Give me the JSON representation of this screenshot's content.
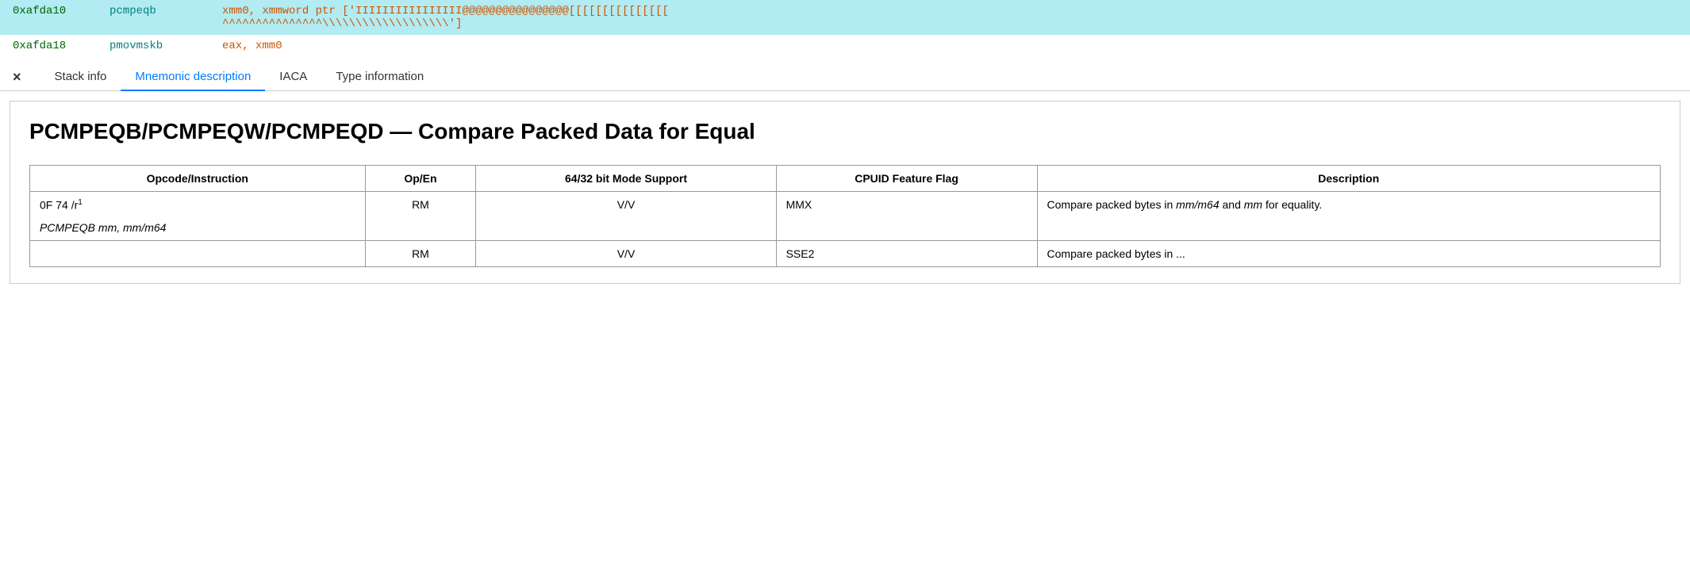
{
  "asm": {
    "rows": [
      {
        "selected": true,
        "addr": "0xafda10",
        "mnemonic": "pcmpeqb",
        "operands": "xmm0, xmmword ptr ['IIIIIIIIIIIIIIII@@@@@@@@@@@@@@@@[[[[[[[[[[[[[[[",
        "operands2": "^^^^^^^^^^^^^^^\\\\\\\\\\\\\\\\\\\\\\\\\\\\\\\\\\\\\\']"
      },
      {
        "selected": false,
        "addr": "0xafda18",
        "mnemonic": "pmovmskb",
        "operands": "eax, xmm0",
        "operands2": ""
      }
    ]
  },
  "tabs": {
    "close_label": "×",
    "items": [
      {
        "id": "stack-info",
        "label": "Stack info",
        "active": false
      },
      {
        "id": "mnemonic-description",
        "label": "Mnemonic description",
        "active": true
      },
      {
        "id": "iaca",
        "label": "IACA",
        "active": false
      },
      {
        "id": "type-information",
        "label": "Type information",
        "active": false
      }
    ]
  },
  "doc": {
    "title": "PCMPEQB/PCMPEQW/PCMPEQD — Compare Packed Data for Equal",
    "table": {
      "headers": [
        "Opcode/Instruction",
        "Op/En",
        "64/32 bit Mode Support",
        "CPUID Feature Flag",
        "Description"
      ],
      "rows": [
        {
          "opcode": "0F 74 /r",
          "superscript": "1",
          "instruction": "PCMPEQB mm, mm/m64",
          "opEn": "RM",
          "mode": "V/V",
          "cpuid": "MMX",
          "description_pre": "Compare packed bytes in ",
          "description_italic1": "mm/m64",
          "description_mid": " and ",
          "description_italic2": "mm",
          "description_post": " for equality."
        },
        {
          "opcode": "",
          "superscript": "",
          "instruction": "",
          "opEn": "RM",
          "mode": "V/V",
          "cpuid": "SSE2",
          "description_pre": "Compare packed bytes in ...",
          "description_italic1": "",
          "description_mid": "",
          "description_italic2": "",
          "description_post": ""
        }
      ]
    }
  }
}
